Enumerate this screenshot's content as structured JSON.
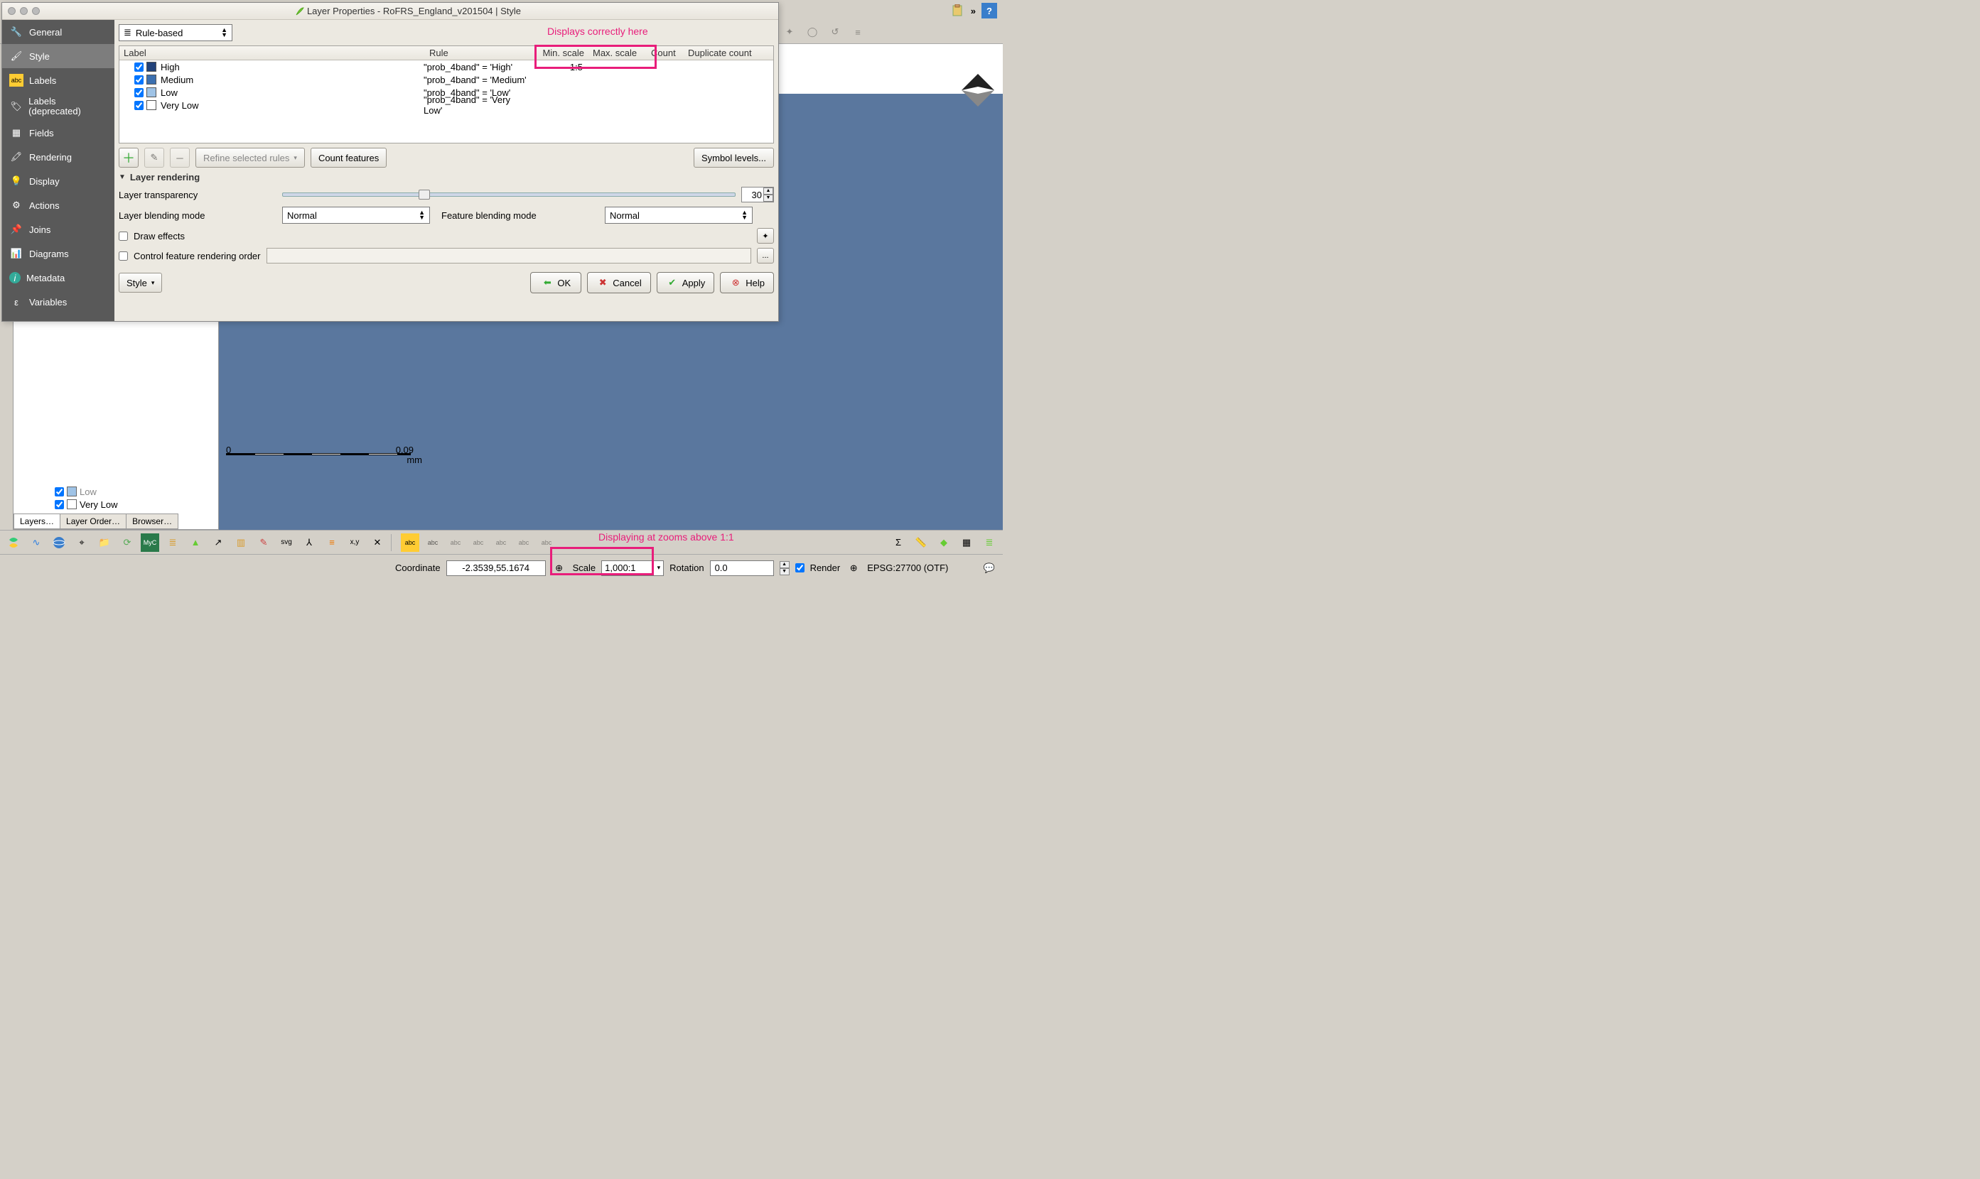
{
  "titlebar": {
    "title": "Layer Properties - RoFRS_England_v201504 | Style"
  },
  "sidebar": {
    "items": [
      {
        "label": "General",
        "icon": "wrench"
      },
      {
        "label": "Style",
        "icon": "brush"
      },
      {
        "label": "Labels",
        "icon": "abc"
      },
      {
        "label": "Labels (deprecated)",
        "icon": "abc-old"
      },
      {
        "label": "Fields",
        "icon": "table"
      },
      {
        "label": "Rendering",
        "icon": "render"
      },
      {
        "label": "Display",
        "icon": "display"
      },
      {
        "label": "Actions",
        "icon": "gear"
      },
      {
        "label": "Joins",
        "icon": "joins"
      },
      {
        "label": "Diagrams",
        "icon": "chart"
      },
      {
        "label": "Metadata",
        "icon": "info"
      },
      {
        "label": "Variables",
        "icon": "epsilon"
      }
    ]
  },
  "renderer": {
    "type": "Rule-based"
  },
  "columns": {
    "label": "Label",
    "rule": "Rule",
    "min": "Min. scale",
    "max": "Max. scale",
    "count": "Count",
    "dup": "Duplicate count"
  },
  "rules": [
    {
      "label": "High",
      "expr": "\"prob_4band\" = 'High'",
      "color": "#22427a",
      "min": "1:5",
      "max": ""
    },
    {
      "label": "Medium",
      "expr": "\"prob_4band\" = 'Medium'",
      "color": "#3c70b0",
      "min": "",
      "max": ""
    },
    {
      "label": "Low",
      "expr": "\"prob_4band\" = 'Low'",
      "color": "#9fc3e6",
      "min": "",
      "max": ""
    },
    {
      "label": "Very Low",
      "expr": "\"prob_4band\" = 'Very Low'",
      "color": "#ffffff",
      "min": "",
      "max": ""
    }
  ],
  "buttons": {
    "refine": "Refine selected rules",
    "countFeatures": "Count features",
    "symbolLevels": "Symbol levels...",
    "style": "Style",
    "ok": "OK",
    "cancel": "Cancel",
    "apply": "Apply",
    "help": "Help"
  },
  "rendering": {
    "header": "Layer rendering",
    "transparencyLabel": "Layer transparency",
    "transparencyValue": "30",
    "layerBlend": "Layer blending mode",
    "layerBlendValue": "Normal",
    "featureBlend": "Feature blending mode",
    "featureBlendValue": "Normal",
    "drawEffects": "Draw effects",
    "controlOrder": "Control feature rendering order",
    "ellipsis": "..."
  },
  "annotations": {
    "top": "Displays correctly here",
    "bottom": "Displaying at zooms above 1:1"
  },
  "layersPanel": {
    "rowLow": "Low",
    "rowVeryLow": "Very Low",
    "tabs": [
      "Layers…",
      "Layer Order…",
      "Browser…"
    ]
  },
  "statusbar": {
    "coordLabel": "Coordinate",
    "coord": "-2.3539,55.1674",
    "scaleLabel": "Scale",
    "scale": "1,000:1",
    "rotationLabel": "Rotation",
    "rotation": "0.0",
    "render": "Render",
    "crs": "EPSG:27700 (OTF)"
  },
  "scalebar": {
    "zero": "0",
    "end": "0.09",
    "unit": "mm"
  },
  "chevrons": "»"
}
